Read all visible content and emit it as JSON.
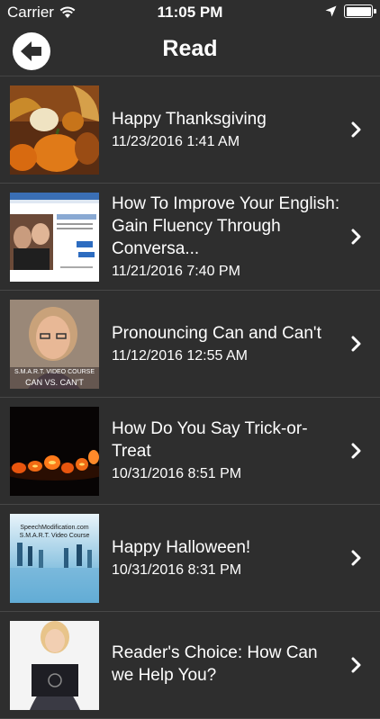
{
  "status_bar": {
    "carrier": "Carrier",
    "time": "11:05 PM"
  },
  "nav": {
    "title": "Read",
    "back_icon": "back-arrow-icon"
  },
  "items": [
    {
      "title": "Happy Thanksgiving",
      "date": "11/23/2016 1:41 AM",
      "thumbnail": "pumpkins"
    },
    {
      "title": "How To Improve Your English:  Gain Fluency Through Conversa...",
      "date": "11/21/2016 7:40 PM",
      "thumbnail": "conversation-webpage"
    },
    {
      "title": "Pronouncing Can and Can't",
      "date": "11/12/2016 12:55 AM",
      "thumbnail": "smart-video-course-presenter",
      "thumb_text_1": "S.M.A.R.T. VIDEO COURSE",
      "thumb_text_2": "CAN VS. CAN'T"
    },
    {
      "title": "How Do You Say Trick-or-Treat",
      "date": "10/31/2016 8:51 PM",
      "thumbnail": "jack-o-lanterns"
    },
    {
      "title": "Happy Halloween!",
      "date": "10/31/2016 8:31 PM",
      "thumbnail": "speechmodification-course",
      "thumb_text_1": "SpeechModification.com",
      "thumb_text_2": "S.M.A.R.T. Video Course"
    },
    {
      "title": "Reader's Choice:  How Can we Help You?",
      "date": "",
      "thumbnail": "woman-with-laptop"
    }
  ]
}
